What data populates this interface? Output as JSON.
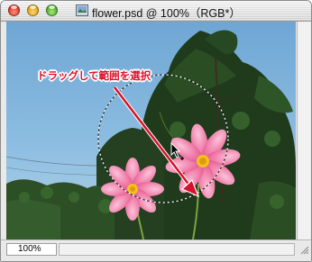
{
  "window": {
    "title": "flower.psd @ 100%（RGB*）"
  },
  "annotation": {
    "text": "ドラッグして範囲を選択",
    "color": "#e0102a"
  },
  "statusbar": {
    "zoom": "100%"
  },
  "colors": {
    "close": "#d0291a",
    "minimize": "#d8960c",
    "zoom": "#3e9d1f",
    "sky": "#7fb4dc",
    "flower": "#f07aa8"
  },
  "icons": {
    "document": "psd-document-icon",
    "cursor": "lasso-cursor-icon",
    "grip": "resize-grip-icon"
  }
}
